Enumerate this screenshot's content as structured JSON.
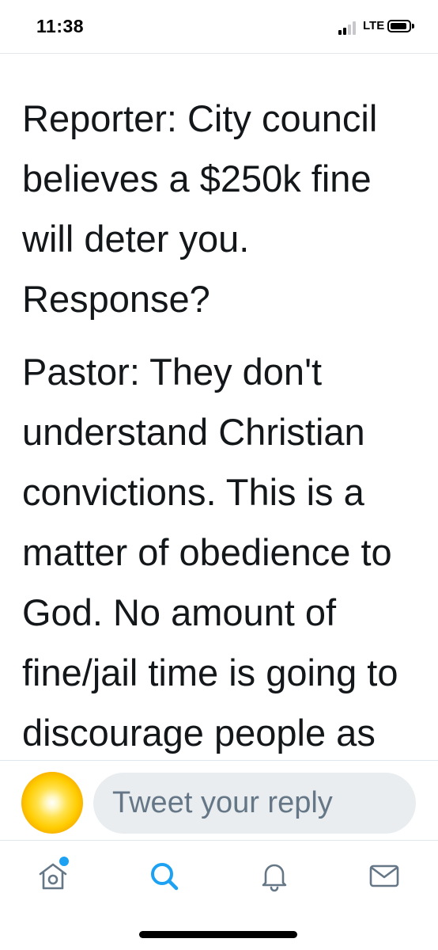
{
  "status_bar": {
    "time": "11:38",
    "network": "LTE",
    "signal_level": "2 of 4 bars"
  },
  "tweet": {
    "paragraphs": [
      "Reporter: City council believes a $250k fine will deter you. Response?",
      "Pastor: They don't understand Christian convictions. This is a matter of obedience to God. No amount of fine/jail time is going to discourage people as they come..."
    ]
  },
  "reply": {
    "placeholder": "Tweet your reply"
  },
  "tab_bar": {
    "accent_color": "#1da1f2",
    "icon_color": "#657786",
    "tabs": [
      {
        "icon": "home-icon",
        "active": false,
        "has_notification_dot": true
      },
      {
        "icon": "search-icon",
        "active": true
      },
      {
        "icon": "bell-icon",
        "active": false
      },
      {
        "icon": "mail-icon",
        "active": false
      }
    ]
  }
}
